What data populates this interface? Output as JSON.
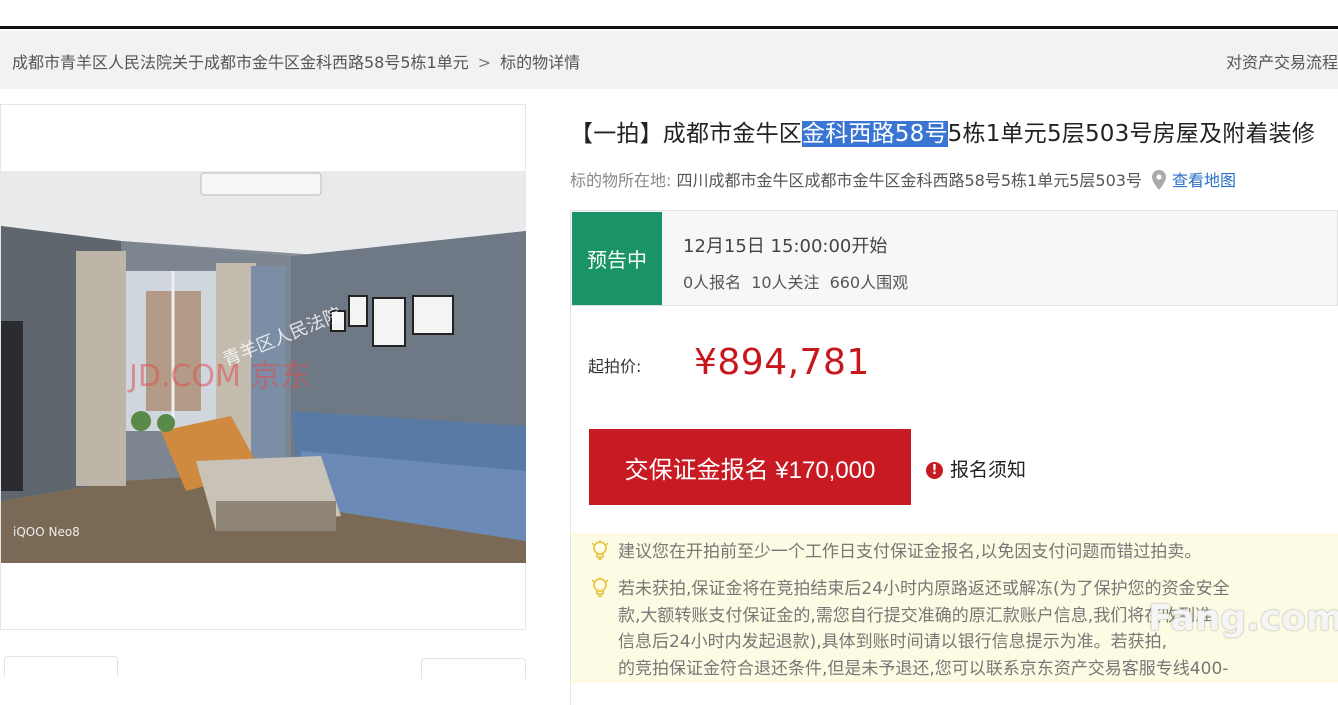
{
  "breadcrumb": {
    "court_link": "成都市青羊区人民法院关于成都市金牛区金科西路58号5栋1单元",
    "separator": ">",
    "current": "标的物详情"
  },
  "header_right": {
    "flow_link": "对资产交易流程"
  },
  "listing": {
    "title_prefix": "【一拍】成都市金牛区",
    "title_highlight": "金科西路58号",
    "title_suffix": "5栋1单元5层503号房屋及附着装修",
    "location_label": "标的物所在地:",
    "location_value": "四川成都市金牛区成都市金牛区金科西路58号5栋1单元5层503号",
    "map_link": "查看地图"
  },
  "status": {
    "tag": "预告中",
    "start_time": "12月15日 15:00:00开始",
    "signups": "0人报名",
    "followers": "10人关注",
    "viewers": "660人围观"
  },
  "price": {
    "label": "起拍价:",
    "value": "¥894,781"
  },
  "actions": {
    "deposit_button": "交保证金报名 ¥170,000",
    "notice_link": "报名须知"
  },
  "tips": [
    "建议您在开拍前至少一个工作日支付保证金报名,以免因支付问题而错过拍卖。",
    "若未获拍,保证金将在竞拍结束后24小时内原路返还或解冻(为了保护您的资金安全",
    "款,大额转账支付保证金的,需您自行提交准确的原汇款账户信息,我们将在收到准",
    "信息后24小时内发起退款),具体到账时间请以银行信息提示为准。若获拍,",
    "的竞拍保证金符合退还条件,但是未予退还,您可以联系京东资产交易客服专线400-"
  ],
  "photo_watermarks": {
    "brand": "JD.COM 京东",
    "court": "青羊区人民法院",
    "camera": "iQOO Neo8"
  },
  "site_watermark": "Fang.com",
  "colors": {
    "accent_red": "#c81a22",
    "status_green": "#1a9467",
    "link_blue": "#2a6fc9",
    "highlight": "#3a75d3"
  }
}
